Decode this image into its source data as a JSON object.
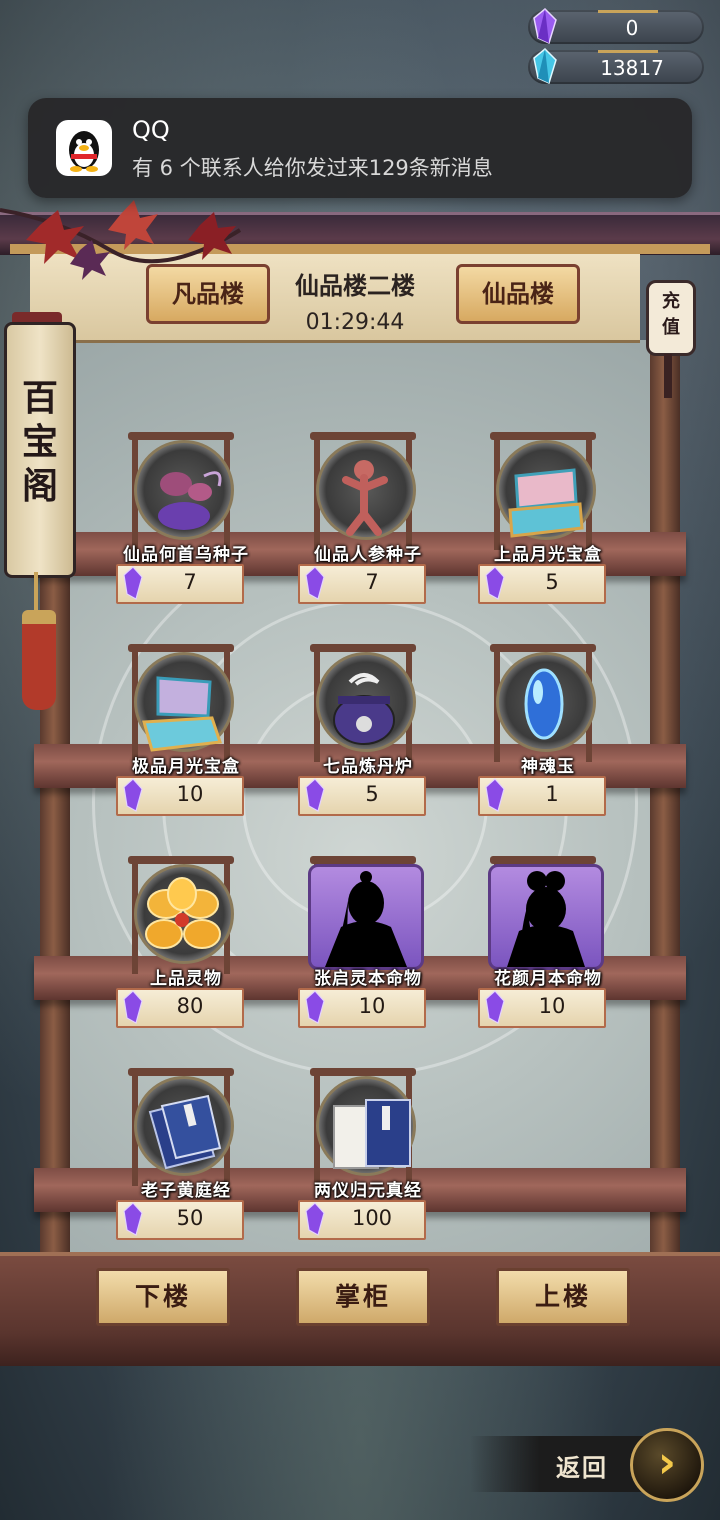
{
  "currency": [
    {
      "icon": "purple-crystal-icon",
      "value": "0"
    },
    {
      "icon": "blue-crystal-icon",
      "value": "13817"
    }
  ],
  "notification": {
    "app": "QQ",
    "icon": "qq-penguin-icon",
    "message": "有 6 个联系人给你发过来129条新消息"
  },
  "header": {
    "left_tab": "凡品楼",
    "title": "仙品楼二楼",
    "timer": "01:29:44",
    "right_tab": "仙品楼"
  },
  "side_scroll": {
    "title": "百宝阁"
  },
  "recharge": {
    "label": "充值"
  },
  "items": [
    {
      "name": "仙品何首乌种子",
      "price": "7"
    },
    {
      "name": "仙品人参种子",
      "price": "7"
    },
    {
      "name": "上品月光宝盒",
      "price": "5"
    },
    {
      "name": "极品月光宝盒",
      "price": "10"
    },
    {
      "name": "七品炼丹炉",
      "price": "5"
    },
    {
      "name": "神魂玉",
      "price": "1"
    },
    {
      "name": "上品灵物",
      "price": "80"
    },
    {
      "name": "张启灵本命物",
      "price": "10"
    },
    {
      "name": "花颜月本命物",
      "price": "10"
    },
    {
      "name": "老子黄庭经",
      "price": "50"
    },
    {
      "name": "两仪归元真经",
      "price": "100"
    }
  ],
  "buttons": {
    "down": "下楼",
    "shopkeeper": "掌柜",
    "up": "上楼"
  },
  "back": {
    "label": "返回"
  },
  "colors": {
    "price_border": "#b26a4a",
    "button_face": "#e3c286",
    "portrait": "#9a70d2"
  }
}
